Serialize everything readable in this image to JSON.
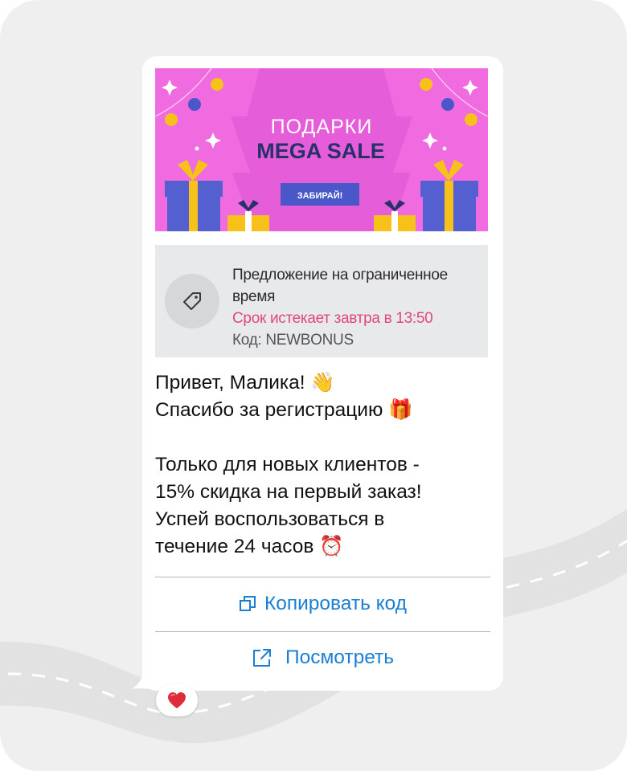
{
  "colors": {
    "background": "#efefef",
    "bubble": "#ffffff",
    "banner_pink": "#f06ae0",
    "banner_navy": "#27316a",
    "banner_button": "#4a57c9",
    "gift_blue": "#5460d0",
    "gift_yellow": "#f6c21a",
    "promo_bg": "#e8e9ea",
    "expire_text": "#e0477a",
    "link_blue": "#1a7fd4"
  },
  "banner": {
    "line1": "ПОДАРКИ",
    "line2": "MEGA SALE",
    "button_label": "ЗАБИРАЙ!"
  },
  "promo": {
    "icon": "tag-icon",
    "title": "Предложение на ограниченное время",
    "expires": "Срок истекает завтра в 13:50",
    "code": "Код: NEWBONUS"
  },
  "message": {
    "line1": "Привет, Малика! 👋",
    "line2": "Спасибо за регистрацию 🎁",
    "line3": "Только для новых клиентов -",
    "line4": "15% скидка на первый заказ!",
    "line5": "Успей воспользоваться в",
    "line6": "течение 24 часов ⏰"
  },
  "actions": {
    "copy_label": "Копировать код",
    "copy_icon": "copy-icon",
    "view_label": "Посмотреть",
    "view_icon": "external-link-icon"
  },
  "reaction": {
    "emoji": "❤️"
  }
}
